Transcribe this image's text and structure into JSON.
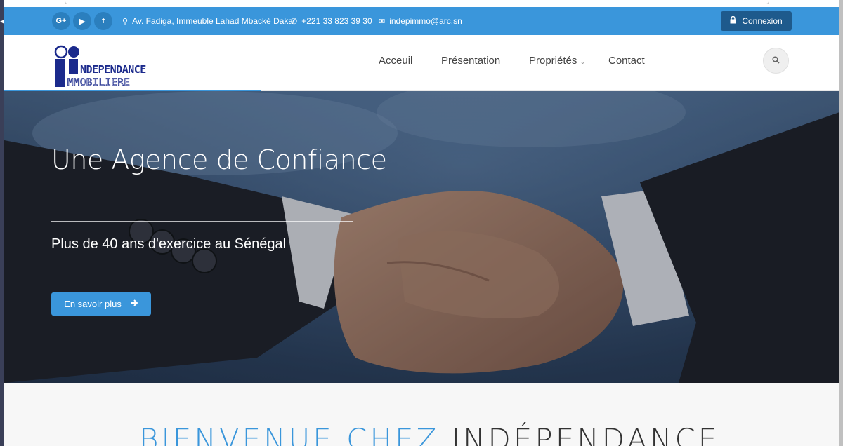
{
  "topbar": {
    "social": [
      {
        "name": "google-plus",
        "glyph": "G+"
      },
      {
        "name": "youtube",
        "glyph": "▶"
      },
      {
        "name": "facebook",
        "glyph": "f"
      }
    ],
    "address": "Av. Fadiga, Immeuble Lahad Mbacké Dakar",
    "phone": "+221 33 823 39 30",
    "email": "indepimmo@arc.sn",
    "login_label": "Connexion"
  },
  "nav": {
    "items": [
      "Acceuil",
      "Présentation",
      "Propriétés",
      "Contact"
    ]
  },
  "logo": {
    "line1": "NDEPENDANCE",
    "line2": "MMOBILIERE"
  },
  "hero": {
    "title": "Une Agence de Confiance",
    "subtitle": "Plus de 40 ans d'exercice au Sénégal",
    "cta_label": "En savoir plus"
  },
  "welcome": {
    "part1": "BIENVENUE CHEZ",
    "part2": "INDÉPENDANCE"
  },
  "colors": {
    "accent": "#3a96db",
    "dark_button": "#1e5a8c"
  }
}
